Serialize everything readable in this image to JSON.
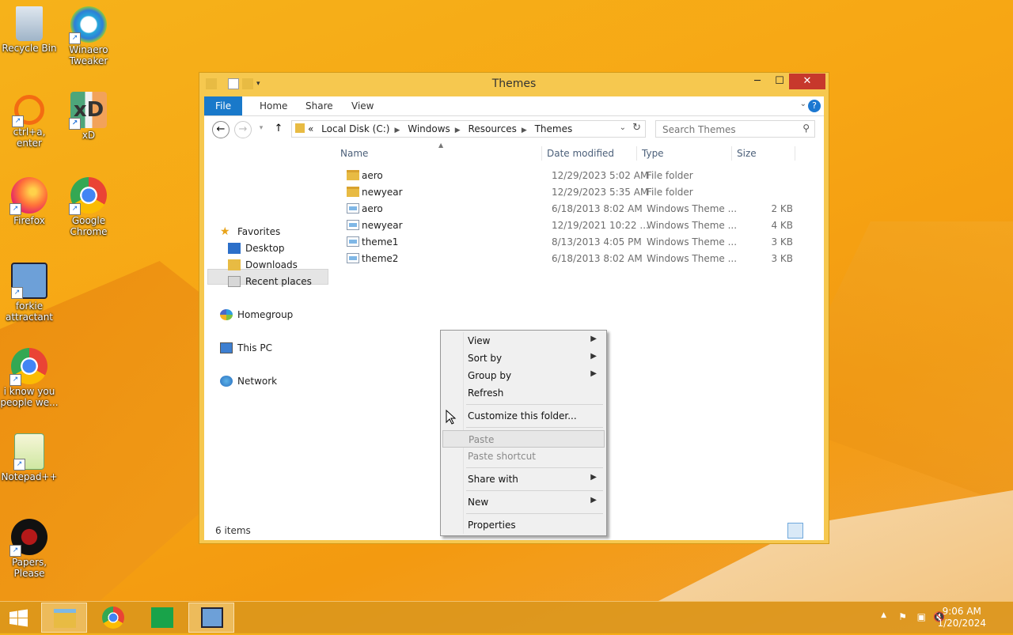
{
  "desktop": {
    "icons": [
      {
        "label": "Recycle Bin",
        "icon": "recycle-bin-icon"
      },
      {
        "label": "Winaero Tweaker",
        "icon": "winaero-icon"
      },
      {
        "label": "ctrl+a, enter",
        "icon": "orange-ring-icon"
      },
      {
        "label": "xD",
        "icon": "xd-icon"
      },
      {
        "label": "Firefox",
        "icon": "firefox-icon"
      },
      {
        "label": "Google Chrome",
        "icon": "chrome-icon"
      },
      {
        "label": "forkie attractant",
        "icon": "computer-gears-icon"
      },
      {
        "label": "i know you people we...",
        "icon": "chrome-icon"
      },
      {
        "label": "Notepad++",
        "icon": "notepadpp-icon"
      },
      {
        "label": "Papers, Please",
        "icon": "papers-please-icon"
      }
    ]
  },
  "window": {
    "title": "Themes",
    "controls": {
      "minimize": "─",
      "maximize": "☐",
      "close": "✕"
    },
    "ribbon_tabs": [
      "File",
      "Home",
      "Share",
      "View"
    ],
    "address": {
      "prefix": "«",
      "crumbs": [
        "Local Disk (C:)",
        "Windows",
        "Resources",
        "Themes"
      ]
    },
    "search_placeholder": "Search Themes",
    "nav": {
      "favorites": "Favorites",
      "desktop": "Desktop",
      "downloads": "Downloads",
      "recent": "Recent places",
      "homegroup": "Homegroup",
      "thispc": "This PC",
      "network": "Network"
    },
    "columns": [
      "Name",
      "Date modified",
      "Type",
      "Size"
    ],
    "files": [
      {
        "name": "aero",
        "date": "12/29/2023 5:02 AM",
        "type": "File folder",
        "size": "",
        "kind": "folder"
      },
      {
        "name": "newyear",
        "date": "12/29/2023 5:35 AM",
        "type": "File folder",
        "size": "",
        "kind": "folder"
      },
      {
        "name": "aero",
        "date": "6/18/2013 8:02 AM",
        "type": "Windows Theme ...",
        "size": "2 KB",
        "kind": "theme"
      },
      {
        "name": "newyear",
        "date": "12/19/2021 10:22 ...",
        "type": "Windows Theme ...",
        "size": "4 KB",
        "kind": "theme"
      },
      {
        "name": "theme1",
        "date": "8/13/2013 4:05 PM",
        "type": "Windows Theme ...",
        "size": "3 KB",
        "kind": "theme"
      },
      {
        "name": "theme2",
        "date": "6/18/2013 8:02 AM",
        "type": "Windows Theme ...",
        "size": "3 KB",
        "kind": "theme"
      }
    ],
    "status": "6 items"
  },
  "context_menu": {
    "items": [
      {
        "label": "View",
        "submenu": true
      },
      {
        "label": "Sort by",
        "submenu": true
      },
      {
        "label": "Group by",
        "submenu": true
      },
      {
        "label": "Refresh",
        "submenu": false
      },
      {
        "label": "Customize this folder...",
        "submenu": false
      },
      {
        "label": "Paste",
        "submenu": false,
        "disabled": true
      },
      {
        "label": "Paste shortcut",
        "submenu": false,
        "disabled": true
      },
      {
        "label": "Share with",
        "submenu": true
      },
      {
        "label": "New",
        "submenu": true
      },
      {
        "label": "Properties",
        "submenu": false
      }
    ]
  },
  "taskbar": {
    "time": "9:06 AM",
    "date": "1/20/2024"
  },
  "colors": {
    "accent": "#1979ca",
    "close": "#c7382c",
    "window_frame": "#f6c84f"
  }
}
